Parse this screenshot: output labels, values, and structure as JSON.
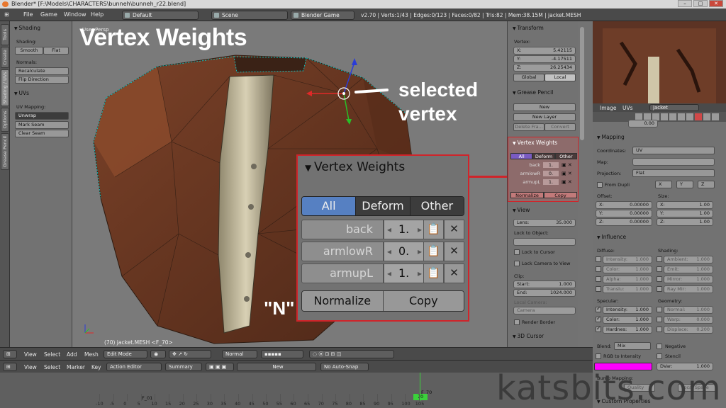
{
  "window": {
    "title": "Blender* [F:\\Models\\CHARACTERS\\bunneh\\bunneh_r22.blend]",
    "controls": [
      "–",
      "□",
      "✕"
    ]
  },
  "menubar": {
    "items": [
      "File",
      "Game",
      "Window",
      "Help"
    ],
    "screen_layout": "Default",
    "scene": "Scene",
    "engine": "Blender Game",
    "stats": "v2.70 | Verts:1/43 | Edges:0/123 | Faces:0/82 | Tris:82 | Mem:38.15M | jacket.MESH"
  },
  "tool_tabs": [
    "Tools",
    "Create",
    "Shading / UVs",
    "Options",
    "Grease Pencil"
  ],
  "toolshelf": {
    "shading_title": "Shading",
    "shading_label": "Shading:",
    "smooth": "Smooth",
    "flat": "Flat",
    "normals_label": "Normals:",
    "recalculate": "Recalculate",
    "flip_direction": "Flip Direction",
    "uvs_title": "UVs",
    "uv_mapping_label": "UV Mapping:",
    "unwrap": "Unwrap",
    "mark_seam": "Mark Seam",
    "clear_seam": "Clear Seam"
  },
  "viewport": {
    "corner_label": "User Persp",
    "overlay_title": "Vertex Weights",
    "selected_line1": "selected",
    "selected_line2": "vertex",
    "n_hint": "\"N\"",
    "status": "(70) jacket.MESH <F_70>"
  },
  "vertex_weights": {
    "title": "Vertex Weights",
    "tabs": [
      "All",
      "Deform",
      "Other"
    ],
    "active_tab": "All",
    "groups": [
      {
        "name": "back",
        "value": "1."
      },
      {
        "name": "armlowR",
        "value": "0."
      },
      {
        "name": "armupL",
        "value": "1."
      }
    ],
    "normalize": "Normalize",
    "copy": "Copy"
  },
  "npanel": {
    "transform_title": "Transform",
    "vertex_label": "Vertex:",
    "x_label": "X:",
    "x": "5.42115",
    "y_label": "Y:",
    "y": "-4.17511",
    "z_label": "Z:",
    "z": "26.25434",
    "global": "Global",
    "local": "Local",
    "grease_title": "Grease Pencil",
    "new": "New",
    "new_layer": "New Layer",
    "delete_frame": "Delete Fra...",
    "convert": "Convert",
    "view_title": "View",
    "lens_label": "Lens:",
    "lens": "35.000",
    "lock_to_object": "Lock to Object:",
    "lock_to_cursor": "Lock to Cursor",
    "lock_camera": "Lock Camera to View",
    "clip_label": "Clip:",
    "start_label": "Start:",
    "start": "1.000",
    "end_label": "End:",
    "end": "1024.000",
    "local_camera": "Local Camera:",
    "camera": "Camera",
    "render_border": "Render Border",
    "cursor_title": "3D Cursor"
  },
  "properties": {
    "image": "Image",
    "uvs": "UVs",
    "datablock": "jacket",
    "partial_top": "0.00",
    "mapping_title": "Mapping",
    "coordinates_label": "Coordinates:",
    "coordinates": "UV",
    "map_label": "Map:",
    "projection_label": "Projection:",
    "projection": "Flat",
    "from_dupli": "From Dupli",
    "axis_x": "X",
    "axis_y": "Y",
    "axis_z": "Z",
    "offset_label": "Offset:",
    "size_label": "Size:",
    "offset": [
      {
        "k": "X:",
        "v": "0.00000"
      },
      {
        "k": "Y:",
        "v": "0.00000"
      },
      {
        "k": "Z:",
        "v": "0.00000"
      }
    ],
    "size": [
      {
        "k": "X:",
        "v": "1.00"
      },
      {
        "k": "Y:",
        "v": "1.00"
      },
      {
        "k": "Z:",
        "v": "1.00"
      }
    ],
    "influence_title": "Influence",
    "diffuse_label": "Diffuse:",
    "shading_label": "Shading:",
    "diffuse": [
      {
        "k": "Intensity:",
        "v": "1.000"
      },
      {
        "k": "Color:",
        "v": "1.000"
      },
      {
        "k": "Alpha:",
        "v": "1.000"
      },
      {
        "k": "Translu:",
        "v": "1.000"
      }
    ],
    "shading": [
      {
        "k": "Ambient:",
        "v": "1.000"
      },
      {
        "k": "Emit:",
        "v": "1.000"
      },
      {
        "k": "Mirror:",
        "v": "1.000"
      },
      {
        "k": "Ray Mir:",
        "v": "1.000"
      }
    ],
    "specular_label": "Specular:",
    "geometry_label": "Geometry:",
    "specular": [
      {
        "k": "Intensity:",
        "v": "1.000"
      },
      {
        "k": "Color:",
        "v": "1.000"
      },
      {
        "k": "Hardnes:",
        "v": "1.000"
      }
    ],
    "geometry": [
      {
        "k": "Normal:",
        "v": "1.000"
      },
      {
        "k": "Warp:",
        "v": "0.000"
      },
      {
        "k": "Displace:",
        "v": "0.200"
      }
    ],
    "blend_label": "Blend:",
    "blend": "Mix",
    "negative": "Negative",
    "rgb_to_intensity": "RGB to Intensity",
    "stencil": "Stencil",
    "dvar_label": "DVar:",
    "dvar": "1.000",
    "bump_mapping": "Bump Mapping:",
    "quality": "Quality",
    "local_space": "Local Space",
    "custom_properties": "Custom Properties",
    "swatch_color": "#ff00ff"
  },
  "view_header": {
    "view": "View",
    "select": "Select",
    "add": "Add",
    "mesh": "Mesh",
    "mode": "Edit Mode",
    "orientation": "Normal"
  },
  "anim_header": {
    "view": "View",
    "select": "Select",
    "marker": "Marker",
    "key": "Key",
    "editor": "Action Editor",
    "summary": "Summary",
    "new": "New",
    "snap": "No Auto-Snap"
  },
  "timeline": {
    "frame_label": "F_01",
    "current_frame_label": "F_70",
    "current_frame": "70",
    "ticks": [
      "-10",
      "-5",
      "0",
      "5",
      "10",
      "15",
      "20",
      "25",
      "30",
      "35",
      "40",
      "45",
      "50",
      "55",
      "60",
      "65",
      "70",
      "75",
      "80",
      "85",
      "90",
      "95",
      "100",
      "105"
    ]
  },
  "watermark": "katsbits.com",
  "colors": {
    "accent_red": "#d0242a",
    "selection_blue": "#5680c2",
    "cloth_brown": "#6b3a24"
  }
}
